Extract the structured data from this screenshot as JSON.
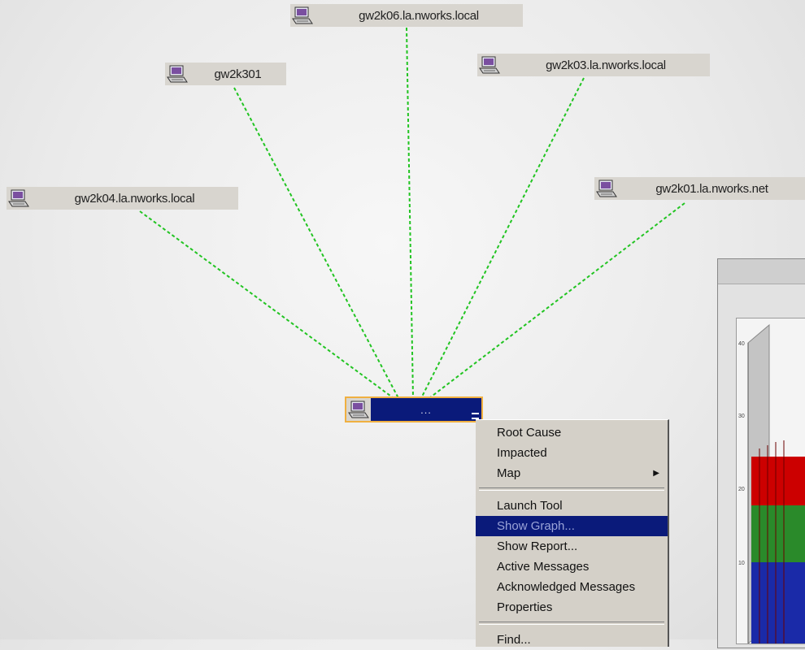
{
  "nodes": [
    {
      "label": "gw2k06.la.nworks.local"
    },
    {
      "label": "gw2k301"
    },
    {
      "label": "gw2k03.la.nworks.local"
    },
    {
      "label": "gw2k04.la.nworks.local"
    },
    {
      "label": "gw2k01.la.nworks.net"
    }
  ],
  "selected_node": {
    "label": "..."
  },
  "context_menu": {
    "group1": [
      {
        "label": "Root Cause"
      },
      {
        "label": "Impacted"
      },
      {
        "label": "Map",
        "submenu": true
      }
    ],
    "group2": [
      {
        "label": "Launch Tool"
      },
      {
        "label": "Show Graph...",
        "highlighted": true
      },
      {
        "label": "Show Report..."
      },
      {
        "label": "Active Messages"
      },
      {
        "label": "Acknowledged Messages"
      },
      {
        "label": "Properties"
      }
    ],
    "group3": [
      {
        "label": "Find..."
      }
    ]
  },
  "graph_window": {
    "y_ticks": [
      "40",
      "30",
      "20",
      "10"
    ],
    "series_colors": [
      "#cc0000",
      "#2a8a2a",
      "#1a2aa8"
    ]
  },
  "colors": {
    "link": "#22c422",
    "node_bg": "#d8d5cf",
    "selection_bg": "#0a1a7a",
    "selection_border": "#f0b040",
    "menu_bg": "#d4d0c8"
  },
  "icons": {
    "node": "computer-node-icon"
  }
}
